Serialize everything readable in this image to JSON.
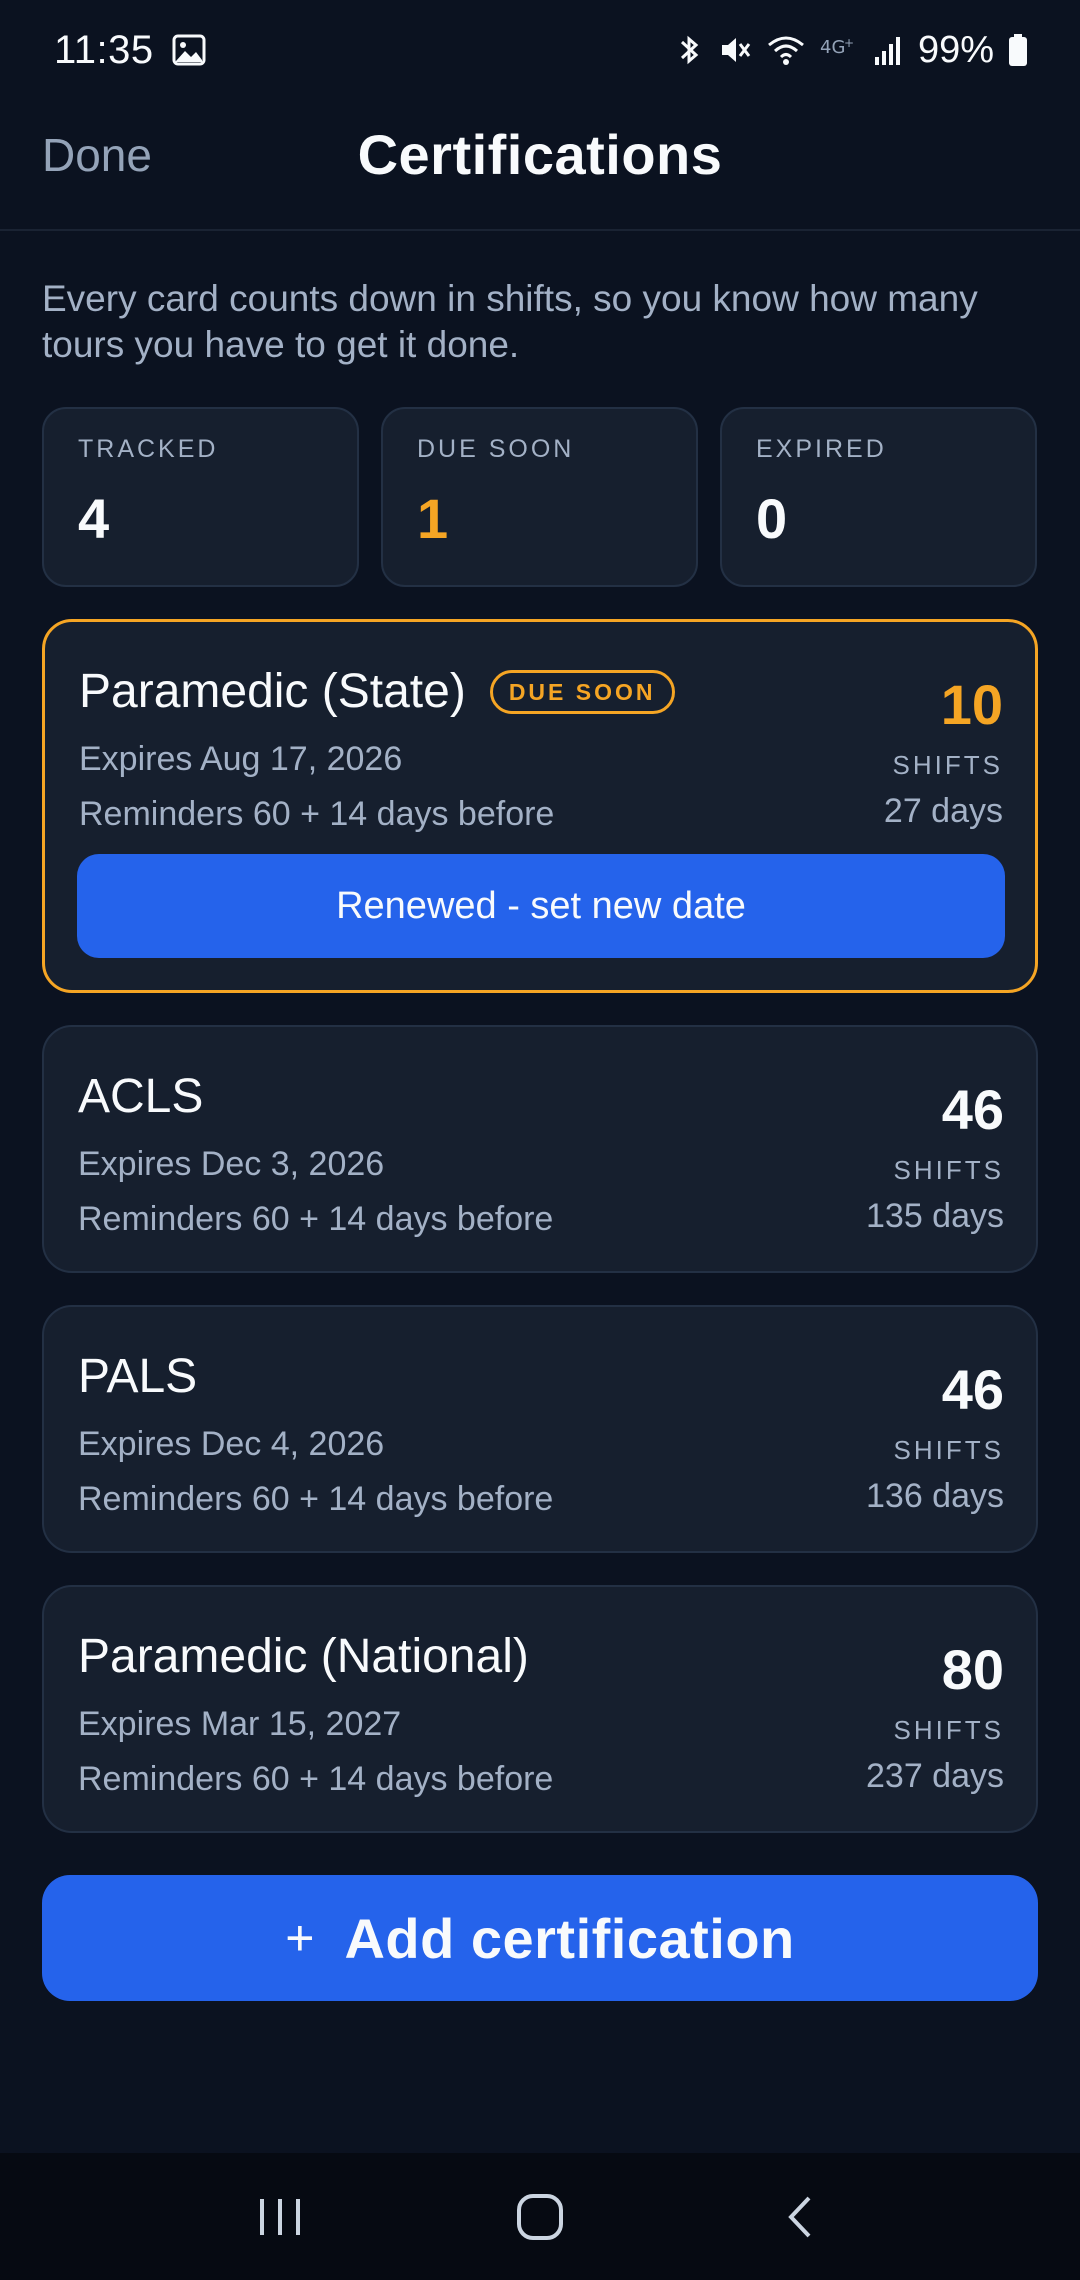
{
  "status_bar": {
    "time": "11:35",
    "battery": "99%",
    "icons": [
      "gallery-icon",
      "bluetooth-icon",
      "mute-icon",
      "wifi-icon",
      "4g-icon",
      "signal-icon",
      "battery-icon"
    ]
  },
  "header": {
    "done_label": "Done",
    "title": "Certifications"
  },
  "intro_text": "Every card counts down in shifts, so you know how many tours you have to get it done.",
  "stats": [
    {
      "label": "TRACKED",
      "value": "4"
    },
    {
      "label": "DUE SOON",
      "value": "1"
    },
    {
      "label": "EXPIRED",
      "value": "0"
    }
  ],
  "certifications": [
    {
      "name": "Paramedic (State)",
      "badge": "DUE SOON",
      "expires": "Expires Aug 17, 2026",
      "reminders": "Reminders 60 + 14 days before",
      "shifts": "10",
      "unit": "SHIFTS",
      "days": "27 days",
      "action_label": "Renewed - set new date"
    },
    {
      "name": "ACLS",
      "expires": "Expires Dec 3, 2026",
      "reminders": "Reminders 60 + 14 days before",
      "shifts": "46",
      "unit": "SHIFTS",
      "days": "135 days"
    },
    {
      "name": "PALS",
      "expires": "Expires Dec 4, 2026",
      "reminders": "Reminders 60 + 14 days before",
      "shifts": "46",
      "unit": "SHIFTS",
      "days": "136 days"
    },
    {
      "name": "Paramedic (National)",
      "expires": "Expires Mar 15, 2027",
      "reminders": "Reminders 60 + 14 days before",
      "shifts": "80",
      "unit": "SHIFTS",
      "days": "237 days"
    }
  ],
  "add_button": {
    "icon": "plus-icon",
    "label": "Add certification"
  },
  "colors": {
    "background": "#0b1220",
    "card": "#161f2e",
    "accent": "#2563eb",
    "warning": "#f5a524",
    "muted_text": "#a3b1c6"
  },
  "nav": [
    "recents-icon",
    "home-icon",
    "back-icon"
  ]
}
